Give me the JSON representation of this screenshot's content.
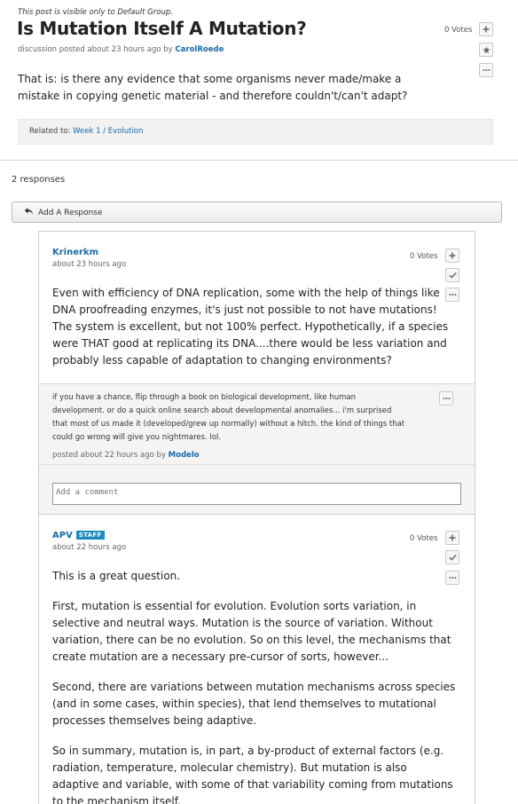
{
  "post": {
    "visibility": "This post is visible only to Default Group.",
    "title": "Is Mutation Itself A Mutation?",
    "meta_prefix": "discussion posted about 23 hours ago by ",
    "author": "CarolRoede",
    "votes": "0 Votes",
    "body": "That is: is there any evidence that some organisms never made/make a mistake in copying genetic material - and therefore couldn't/can't adapt?",
    "related_label": "Related to: ",
    "related_link": "Week 1 / Evolution"
  },
  "responses_count": "2 responses",
  "add_response_label": "Add A Response",
  "icons": {
    "vote": "plus-icon",
    "follow": "star-icon",
    "more": "ellipsis-icon",
    "endorse": "check-icon",
    "reply": "reply-arrow-icon"
  },
  "responses": [
    {
      "author": "Krinerkm",
      "time": "about 23 hours ago",
      "votes": "0 Votes",
      "body": "Even with efficiency of DNA replication, some with the help of things like DNA proofreading enzymes, it's just not possible to not have mutations! The system is excellent, but not 100% perfect. Hypothetically, if a species were THAT good at replicating its DNA....there would be less variation and probably less capable of adaptation to changing environments?",
      "comment": {
        "text": "if you have a chance, flip through a book on biological development, like human development. or do a quick online search about developmental anomalies... i'm surprised that most of us made it (developed/grew up normally) without a hitch. the kind of things that could go wrong will give you nightmares. lol.",
        "meta_prefix": "posted about 22 hours ago by ",
        "author": "Modelo"
      },
      "comment_placeholder": "Add a comment"
    },
    {
      "author": "APV",
      "badge": "STAFF",
      "time": "about 22 hours ago",
      "votes": "0 Votes",
      "paragraphs": [
        "This is a great question.",
        "First, mutation is essential for evolution. Evolution sorts variation, in selective and neutral ways. Mutation is the source of variation. Without variation, there can be no evolution. So on this level, the mechanisms that create mutation are a necessary pre-cursor of sorts, however...",
        "Second, there are variations between mutation mechanisms across species (and in some cases, within species), that lend themselves to mutational processes themselves being adaptive.",
        "So in summary, mutation is, in part, a by-product of external factors (e.g. radiation, temperature, molecular chemistry). But mutation is also adaptive and variable, with some of that variability coming from mutations to the mechanism itself."
      ]
    }
  ]
}
